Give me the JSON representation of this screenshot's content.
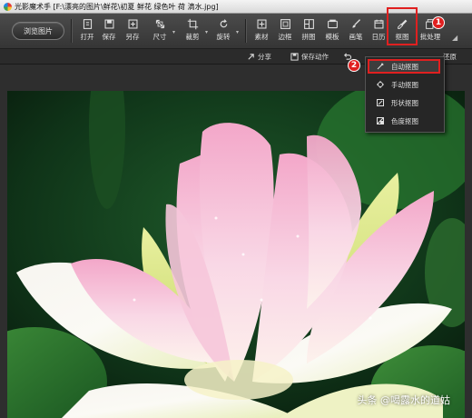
{
  "window": {
    "title": "光影魔术手 [F:\\漂亮的图片\\鲜花\\初夏 鲜花 绿色叶 荷 滴水.jpg]"
  },
  "toolbar": {
    "browse_label": "浏览图片",
    "tools": [
      {
        "label": "打开",
        "icon": "open-icon"
      },
      {
        "label": "保存",
        "icon": "save-icon"
      },
      {
        "label": "另存",
        "icon": "save-as-icon"
      },
      {
        "label": "尺寸",
        "icon": "resize-icon"
      },
      {
        "label": "裁剪",
        "icon": "crop-icon"
      },
      {
        "label": "旋转",
        "icon": "rotate-icon"
      },
      {
        "label": "素材",
        "icon": "material-icon"
      },
      {
        "label": "边框",
        "icon": "border-icon"
      },
      {
        "label": "拼图",
        "icon": "collage-icon"
      },
      {
        "label": "模板",
        "icon": "template-icon"
      },
      {
        "label": "画笔",
        "icon": "brush-icon"
      },
      {
        "label": "日历",
        "icon": "calendar-icon"
      },
      {
        "label": "抠图",
        "icon": "cutout-icon"
      },
      {
        "label": "批处理",
        "icon": "batch-icon"
      }
    ],
    "more_glyph": "◢"
  },
  "subbar": {
    "share_label": "分享",
    "save_action_label": "保存动作",
    "restore_label": "还原"
  },
  "cutout_menu": {
    "items": [
      {
        "label": "自动抠图",
        "icon": "auto-cutout-icon",
        "active": true
      },
      {
        "label": "手动抠图",
        "icon": "manual-cutout-icon",
        "active": false
      },
      {
        "label": "形状抠图",
        "icon": "shape-cutout-icon",
        "active": false
      },
      {
        "label": "色度抠图",
        "icon": "chroma-cutout-icon",
        "active": false
      }
    ]
  },
  "annotations": {
    "badge_1": "1",
    "badge_2": "2",
    "highlight_color": "#e02020"
  },
  "photo": {
    "subject": "pink-white lotus flower with water droplets on dark green background",
    "watermark": "头条 @喝露水的道姑"
  },
  "colors": {
    "toolbar_bg": "#3f3f3f",
    "accent_red": "#e02020"
  }
}
